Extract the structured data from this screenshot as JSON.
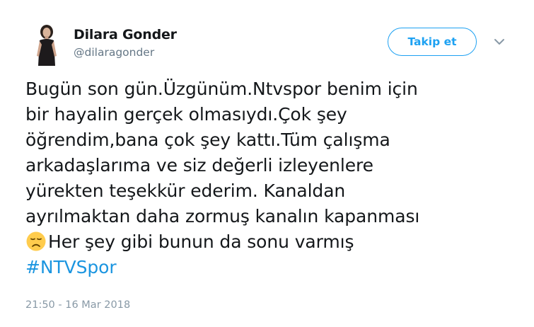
{
  "author": {
    "name": "Dilara Gonder",
    "handle": "@dilaragonder"
  },
  "follow_button": {
    "label": "Takip et"
  },
  "menu": {
    "icon": "chevron-down-icon"
  },
  "tweet": {
    "lines": [
      "Bugün son gün.Üzgünüm.Ntvspor benim için",
      "bir hayalin gerçek olmasıydı.Çok şey",
      "öğrendim,bana çok şey kattı.Tüm çalışma",
      "arkadaşlarıma ve siz değerli izleyenlere",
      "yürekten teşekkür ederim. Kanaldan",
      "ayrılmaktan daha zormuş kanalın kapanması"
    ],
    "last_line": "Her şey gibi bunun da sonu varmış",
    "emoji": "disappointed-face-emoji",
    "hashtag": "#NTVSpor"
  },
  "timestamp": "21:50 - 16 Mar 2018",
  "colors": {
    "accent": "#1da1f2",
    "hashtag": "#1b95e0",
    "secondary_text": "#657786",
    "primary_text": "#14171a"
  }
}
